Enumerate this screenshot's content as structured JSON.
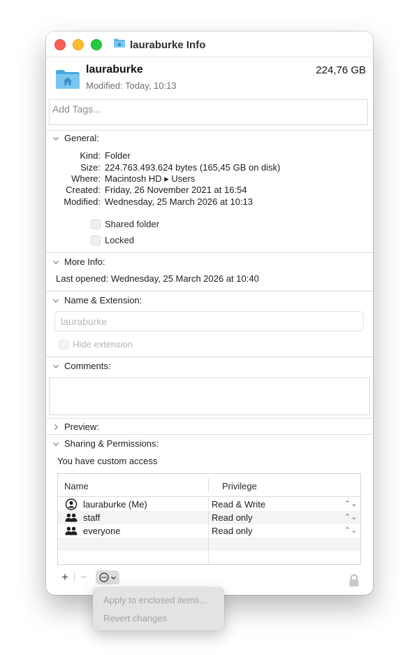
{
  "window": {
    "title": "lauraburke Info"
  },
  "header": {
    "name": "lauraburke",
    "size": "224,76 GB",
    "modified": "Modified: Today, 10:13",
    "tags_placeholder": "Add Tags..."
  },
  "general": {
    "title": "General:",
    "rows": [
      {
        "label": "Kind:",
        "value": "Folder"
      },
      {
        "label": "Size:",
        "value": "224.763.493.624 bytes (165,45 GB on disk)"
      },
      {
        "label": "Where:",
        "value": "Macintosh HD ▸ Users"
      },
      {
        "label": "Created:",
        "value": "Friday, 26 November 2021 at 16:54"
      },
      {
        "label": "Modified:",
        "value": "Wednesday, 25 March 2026 at 10:13"
      }
    ],
    "shared_folder": "Shared folder",
    "locked": "Locked"
  },
  "more_info": {
    "title": "More Info:",
    "last_opened_label": "Last opened:",
    "last_opened_value": "Wednesday, 25 March 2026 at 10:40"
  },
  "name_ext": {
    "title": "Name & Extension:",
    "name_value": "lauraburke",
    "hide_extension": "Hide extension"
  },
  "comments": {
    "title": "Comments:"
  },
  "preview": {
    "title": "Preview:"
  },
  "sharing": {
    "title": "Sharing & Permissions:",
    "access_text": "You have custom access",
    "columns": {
      "name": "Name",
      "privilege": "Privilege"
    },
    "rows": [
      {
        "name": "lauraburke (Me)",
        "privilege": "Read & Write",
        "icon": "user-circle-icon"
      },
      {
        "name": "staff",
        "privilege": "Read only",
        "icon": "group-icon"
      },
      {
        "name": "everyone",
        "privilege": "Read only",
        "icon": "group-icon"
      }
    ],
    "add_label": "+",
    "remove_label": "−"
  },
  "popup_menu": {
    "items": [
      "Apply to enclosed items...",
      "Revert changes"
    ]
  },
  "colors": {
    "close": "#fe5f57",
    "minimize": "#febc2e",
    "maximize": "#28c840",
    "folder_blue": "#5db5ea"
  }
}
